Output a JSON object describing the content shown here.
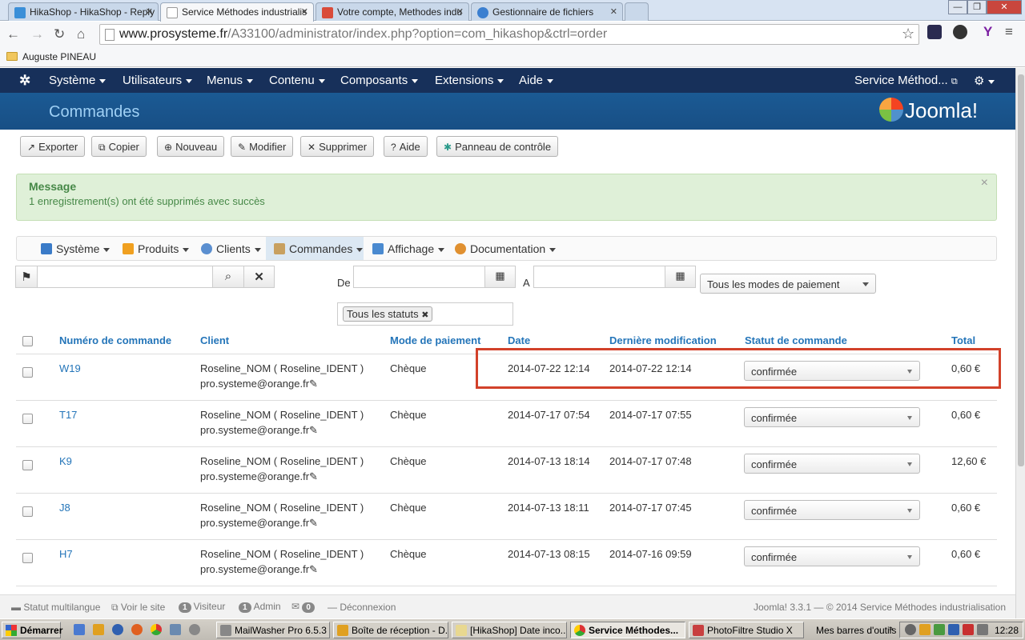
{
  "browser": {
    "tabs": [
      {
        "title": "HikaShop - HikaShop - Reply",
        "color": "#3a8fd8"
      },
      {
        "title": "Service Méthodes industrialis",
        "color": "#ffffff"
      },
      {
        "title": "Votre compte, Methodes indu",
        "color": "#d94b3a"
      },
      {
        "title": "Gestionnaire de fichiers",
        "color": "#3b7fd0"
      }
    ],
    "active_tab": 1,
    "url_host": "www.prosysteme.fr",
    "url_path": "/A33100/administrator/index.php?option=com_hikashop&ctrl=order",
    "bookmark": "Auguste PINEAU"
  },
  "joomla_nav": {
    "menus": [
      "Système",
      "Utilisateurs",
      "Menus",
      "Contenu",
      "Composants",
      "Extensions",
      "Aide"
    ],
    "site_link": "Service Méthod...",
    "page_title": "Commandes",
    "logo_text": "Joomla!"
  },
  "toolbar": [
    {
      "label": "Exporter",
      "icon": "↗"
    },
    {
      "label": "Copier",
      "icon": "⧉"
    },
    {
      "label": "Nouveau",
      "icon": "⊕"
    },
    {
      "label": "Modifier",
      "icon": "✎"
    },
    {
      "label": "Supprimer",
      "icon": "✕"
    },
    {
      "label": "Aide",
      "icon": "?"
    },
    {
      "label": "Panneau de contrôle",
      "icon": "✱"
    }
  ],
  "message": {
    "heading": "Message",
    "text": "1 enregistrement(s) ont été supprimés avec succès",
    "close": "×"
  },
  "hika_menu": [
    {
      "label": "Système",
      "color": "#3a7bc8"
    },
    {
      "label": "Produits",
      "color": "#f0a020"
    },
    {
      "label": "Clients",
      "color": "#5b8fd0"
    },
    {
      "label": "Commandes",
      "color": "#c8a060"
    },
    {
      "label": "Affichage",
      "color": "#4a8ad0"
    },
    {
      "label": "Documentation",
      "color": "#e09030"
    }
  ],
  "filters": {
    "from_label": "De",
    "to_label": "A",
    "payment_select": "Tous les modes de paiement",
    "status_tag": "Tous les statuts"
  },
  "table": {
    "headers": [
      "Numéro de commande",
      "Client",
      "Mode de paiement",
      "Date",
      "Dernière modification",
      "Statut de commande",
      "Total"
    ],
    "rows": [
      {
        "order": "W19",
        "client": "Roseline_NOM ( Roseline_IDENT )",
        "email": "pro.systeme@orange.fr",
        "payment": "Chèque",
        "date": "2014-07-22 12:14",
        "modified": "2014-07-22 12:14",
        "status": "confirmée",
        "total": "0,60 €"
      },
      {
        "order": "T17",
        "client": "Roseline_NOM ( Roseline_IDENT )",
        "email": "pro.systeme@orange.fr",
        "payment": "Chèque",
        "date": "2014-07-17 07:54",
        "modified": "2014-07-17 07:55",
        "status": "confirmée",
        "total": "0,60 €"
      },
      {
        "order": "K9",
        "client": "Roseline_NOM ( Roseline_IDENT )",
        "email": "pro.systeme@orange.fr",
        "payment": "Chèque",
        "date": "2014-07-13 18:14",
        "modified": "2014-07-17 07:48",
        "status": "confirmée",
        "total": "12,60 €"
      },
      {
        "order": "J8",
        "client": "Roseline_NOM ( Roseline_IDENT )",
        "email": "pro.systeme@orange.fr",
        "payment": "Chèque",
        "date": "2014-07-13 18:11",
        "modified": "2014-07-17 07:45",
        "status": "confirmée",
        "total": "0,60 €"
      },
      {
        "order": "H7",
        "client": "Roseline_NOM ( Roseline_IDENT )",
        "email": "pro.systeme@orange.fr",
        "payment": "Chèque",
        "date": "2014-07-13 08:15",
        "modified": "2014-07-16 09:59",
        "status": "confirmée",
        "total": "0,60 €"
      }
    ]
  },
  "footer": {
    "multilang": "Statut multilangue",
    "view_site": "Voir le site",
    "visitors_count": "1",
    "visitors_label": "Visiteur",
    "admin_count": "1",
    "admin_label": "Admin",
    "messages_count": "0",
    "logout": "Déconnexion",
    "version": "Joomla! 3.3.1 — © 2014 Service Méthodes industrialisation"
  },
  "taskbar": {
    "start": "Démarrer",
    "tasks": [
      {
        "label": "MailWasher Pro 6.5.3",
        "color": "#888"
      },
      {
        "label": "Boîte de réception - D...",
        "color": "#e0a020"
      },
      {
        "label": "[HikaShop] Date inco...",
        "color": "#e8d890"
      },
      {
        "label": "Service Méthodes...",
        "color": "#4a9a40"
      },
      {
        "label": "PhotoFiltre Studio X",
        "color": "#c84040"
      }
    ],
    "toolbar_label": "Mes barres d'outils",
    "clock": "12:28"
  }
}
